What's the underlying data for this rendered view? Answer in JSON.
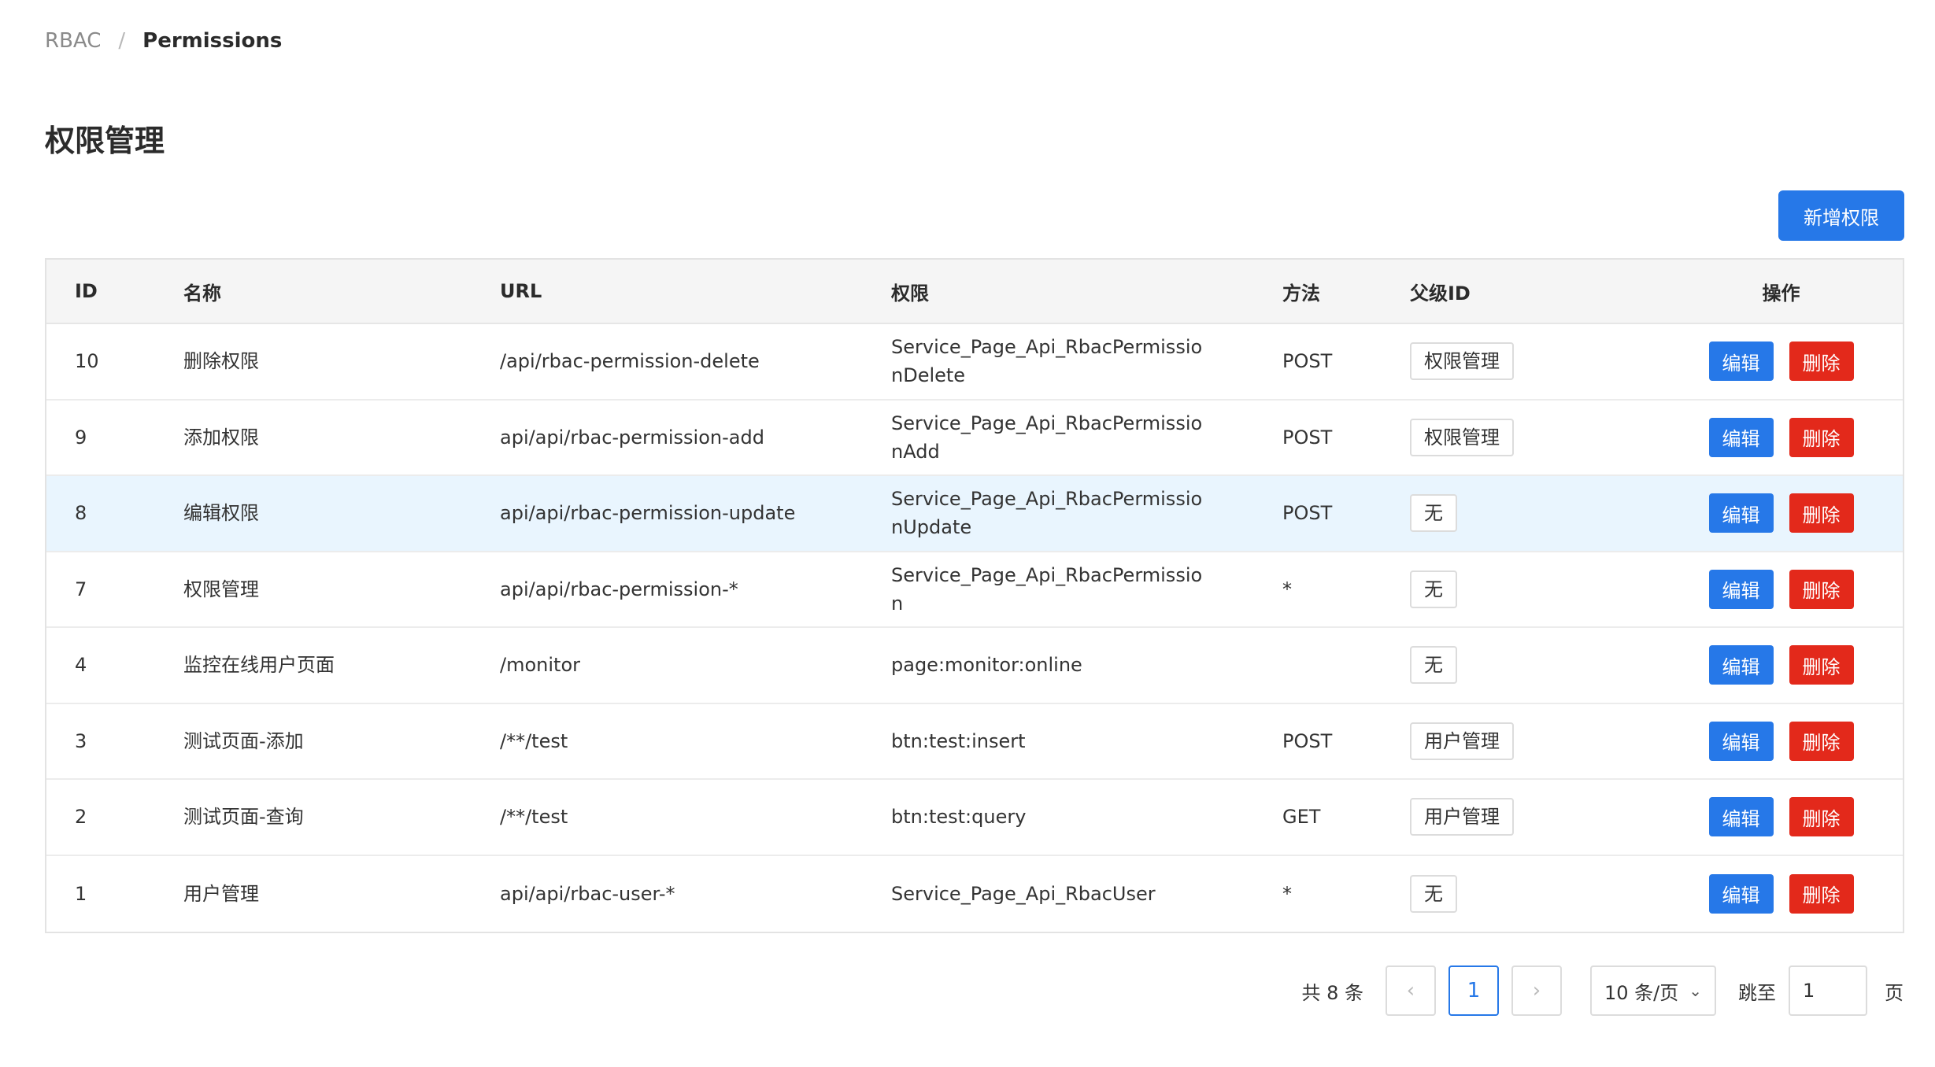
{
  "breadcrumb": {
    "root": "RBAC",
    "separator": "/",
    "current": "Permissions"
  },
  "page_title": "权限管理",
  "add_button": "新增权限",
  "table": {
    "headers": {
      "id": "ID",
      "name": "名称",
      "url": "URL",
      "permission": "权限",
      "method": "方法",
      "parent": "父级ID",
      "ops": "操作"
    },
    "rows": [
      {
        "id": "10",
        "name": "删除权限",
        "url": "/api/rbac-permission-delete",
        "permission": "Service_Page_Api_RbacPermissionDelete",
        "method": "POST",
        "parent": "权限管理"
      },
      {
        "id": "9",
        "name": "添加权限",
        "url": "api/api/rbac-permission-add",
        "permission": "Service_Page_Api_RbacPermissionAdd",
        "method": "POST",
        "parent": "权限管理"
      },
      {
        "id": "8",
        "name": "编辑权限",
        "url": "api/api/rbac-permission-update",
        "permission": "Service_Page_Api_RbacPermissionUpdate",
        "method": "POST",
        "parent": "无"
      },
      {
        "id": "7",
        "name": "权限管理",
        "url": "api/api/rbac-permission-*",
        "permission": "Service_Page_Api_RbacPermission",
        "method": "*",
        "parent": "无"
      },
      {
        "id": "4",
        "name": "监控在线用户页面",
        "url": "/monitor",
        "permission": "page:monitor:online",
        "method": "",
        "parent": "无"
      },
      {
        "id": "3",
        "name": "测试页面-添加",
        "url": "/**/test",
        "permission": "btn:test:insert",
        "method": "POST",
        "parent": "用户管理"
      },
      {
        "id": "2",
        "name": "测试页面-查询",
        "url": "/**/test",
        "permission": "btn:test:query",
        "method": "GET",
        "parent": "用户管理"
      },
      {
        "id": "1",
        "name": "用户管理",
        "url": "api/api/rbac-user-*",
        "permission": "Service_Page_Api_RbacUser",
        "method": "*",
        "parent": "无"
      }
    ],
    "edit_label": "编辑",
    "delete_label": "删除"
  },
  "pagination": {
    "total": "共 8 条",
    "prev_icon": "‹",
    "next_icon": "›",
    "current_page": "1",
    "page_size": "10 条/页",
    "jump_label": "跳至",
    "jump_value": "1",
    "page_label": "页"
  },
  "colors": {
    "primary": "#2678e8",
    "danger": "#e3291b",
    "highlight_row": "#e9f5fe"
  }
}
